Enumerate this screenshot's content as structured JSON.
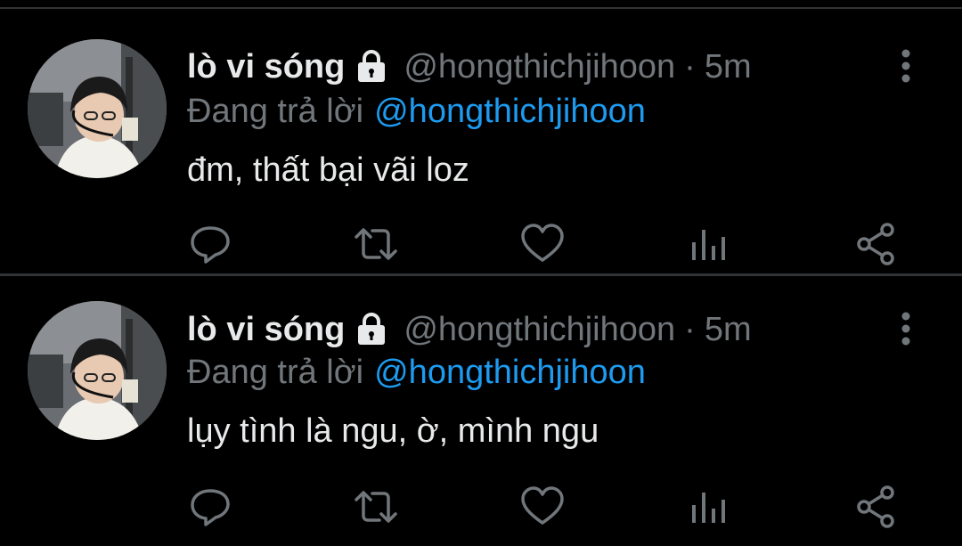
{
  "theme": {
    "background": "#000000",
    "primary_text": "#e7e9ea",
    "secondary_text": "#71767b",
    "link": "#1d9bf0",
    "divider": "#2f3336"
  },
  "tweets": [
    {
      "display_name": "lò vi sóng",
      "handle": "@hongthichjihoon",
      "separator": "·",
      "time": "5m",
      "reply_prefix": "Đang trả lời",
      "reply_mention": "@hongthichjihoon",
      "text": "đm, thất bại vãi loz",
      "icons": [
        "lock-icon",
        "more-icon",
        "reply-icon",
        "retweet-icon",
        "like-icon",
        "analytics-icon",
        "share-icon"
      ]
    },
    {
      "display_name": "lò vi sóng",
      "handle": "@hongthichjihoon",
      "separator": "·",
      "time": "5m",
      "reply_prefix": "Đang trả lời",
      "reply_mention": "@hongthichjihoon",
      "text": "lụy tình là ngu, ờ, mình ngu",
      "icons": [
        "lock-icon",
        "more-icon",
        "reply-icon",
        "retweet-icon",
        "like-icon",
        "analytics-icon",
        "share-icon"
      ]
    }
  ]
}
